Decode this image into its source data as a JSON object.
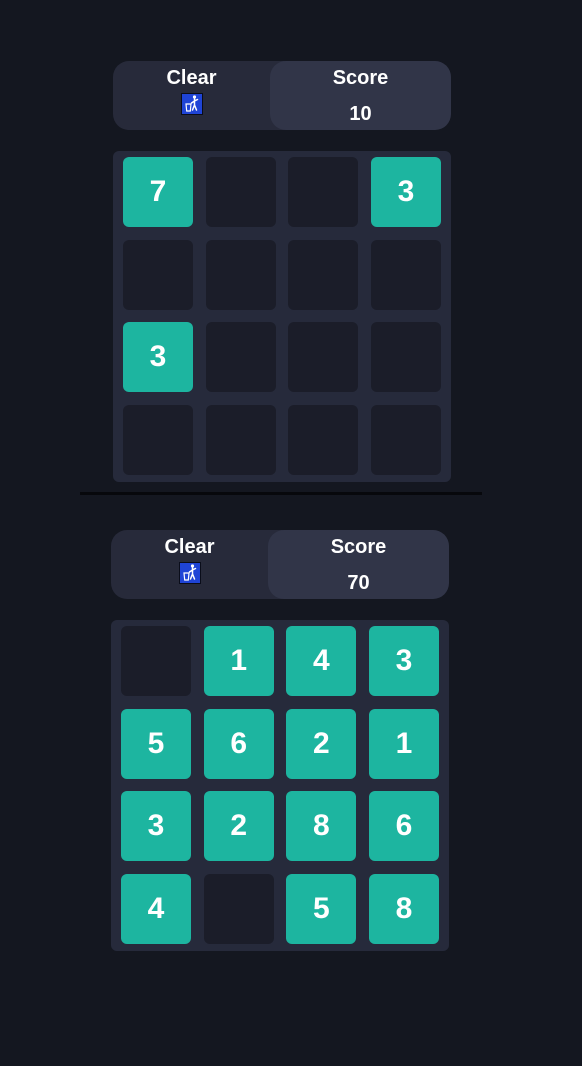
{
  "colors": {
    "page_background": "#141720",
    "header_background": "#272a3a",
    "score_background": "#313548",
    "board_background": "#262a3b",
    "empty_tile": "#1b1d29",
    "filled_tile": "#1db5a0",
    "text": "#ffffff",
    "trash_icon": "#1f44d6"
  },
  "games": [
    {
      "clear_label": "Clear",
      "clear_icon": "trash-icon",
      "score_label": "Score",
      "score_value": "10",
      "board": [
        [
          "7",
          "",
          "",
          "3"
        ],
        [
          "",
          "",
          "",
          ""
        ],
        [
          "3",
          "",
          "",
          ""
        ],
        [
          "",
          "",
          "",
          ""
        ]
      ]
    },
    {
      "clear_label": "Clear",
      "clear_icon": "trash-icon",
      "score_label": "Score",
      "score_value": "70",
      "board": [
        [
          "",
          "1",
          "4",
          "3"
        ],
        [
          "5",
          "6",
          "2",
          "1"
        ],
        [
          "3",
          "2",
          "8",
          "6"
        ],
        [
          "4",
          "",
          "5",
          "8"
        ]
      ]
    }
  ]
}
